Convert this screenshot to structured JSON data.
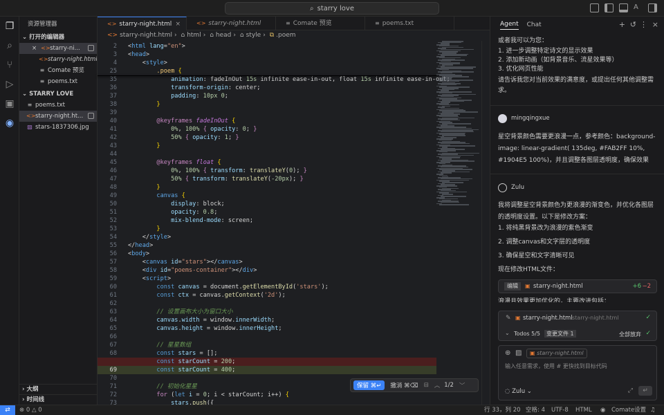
{
  "search": {
    "text": "starry love"
  },
  "sidebar": {
    "title": "资源管理器",
    "open_editors_label": "打开的编辑器",
    "open_editors": [
      {
        "name": "starry-ni...",
        "icon": "html-file-icon",
        "close": "×",
        "selected": true
      },
      {
        "name": "starry-night.html",
        "icon": "html-file-icon",
        "italic": true
      },
      {
        "name": "Comate 预览",
        "icon": "preview-icon"
      },
      {
        "name": "poems.txt",
        "icon": "text-file-icon"
      }
    ],
    "folder_label": "STARRY LOVE",
    "files": [
      {
        "name": "poems.txt",
        "icon": "text-file-icon"
      },
      {
        "name": "starry-night.ht...",
        "icon": "html-file-icon",
        "selected": true
      },
      {
        "name": "stars-1837306.jpg",
        "icon": "image-file-icon"
      }
    ],
    "outline_label": "大纲",
    "timeline_label": "时间线"
  },
  "tabs": [
    {
      "label": "starry-night.html",
      "active": true
    },
    {
      "label": "starry-night.html",
      "italic": true
    },
    {
      "label": "Comate 预览"
    },
    {
      "label": "poems.txt"
    }
  ],
  "breadcrumb": [
    "starry-night.html",
    "html",
    "head",
    "style",
    ".poem"
  ],
  "code_lines": [
    {
      "n": "2",
      "h": "<span class='p'>&lt;</span><span class='t'>html</span> <span class='a'>lang</span><span class='p'>=</span><span class='s'>\"en\"</span><span class='p'>&gt;</span>"
    },
    {
      "n": "3",
      "h": "<span class='p'>&lt;</span><span class='t'>head</span><span class='p'>&gt;</span>"
    },
    {
      "n": "4",
      "h": "    <span class='p'>&lt;</span><span class='t'>style</span><span class='p'>&gt;</span>"
    },
    {
      "n": "25",
      "h": "        <span class='cl'>.poem</span> <span class='y'>{</span>"
    },
    {
      "n": "35",
      "h": "            <span class='a'>animation</span><span class='p'>: fadeInOut </span><span class='num'>15s</span><span class='p'> infinite ease-in-out, float </span><span class='num'>15s</span><span class='p'> infinite ease-in-out;</span>"
    },
    {
      "n": "36",
      "h": "            <span class='a'>transform-origin</span><span class='p'>: center;</span>"
    },
    {
      "n": "37",
      "h": "            <span class='a'>padding</span><span class='p'>: </span><span class='num'>10px</span><span class='p'> </span><span class='num'>0</span><span class='p'>;</span>"
    },
    {
      "n": "38",
      "h": "        <span class='y'>}</span>"
    },
    {
      "n": "39",
      "h": ""
    },
    {
      "n": "40",
      "h": "        <span class='k'>@keyframes</span> <span class='kf'>fadeInOut</span> <span class='y'>{</span>"
    },
    {
      "n": "41",
      "h": "            <span class='num'>0%</span><span class='p'>, </span><span class='num'>100%</span> <span class='k'>{</span> <span class='a'>opacity</span><span class='p'>: </span><span class='num'>0</span><span class='p'>; </span><span class='k'>}</span>"
    },
    {
      "n": "42",
      "h": "            <span class='num'>50%</span> <span class='k'>{</span> <span class='a'>opacity</span><span class='p'>: </span><span class='num'>1</span><span class='p'>; </span><span class='k'>}</span>"
    },
    {
      "n": "43",
      "h": "        <span class='y'>}</span>"
    },
    {
      "n": "44",
      "h": ""
    },
    {
      "n": "45",
      "h": "        <span class='k'>@keyframes</span> <span class='kf'>float</span> <span class='y'>{</span>"
    },
    {
      "n": "46",
      "h": "            <span class='num'>0%</span><span class='p'>, </span><span class='num'>100%</span> <span class='k'>{</span> <span class='a'>transform</span><span class='p'>: </span><span class='f'>translateY</span><span class='p'>(</span><span class='num'>0</span><span class='p'>); </span><span class='k'>}</span>"
    },
    {
      "n": "47",
      "h": "            <span class='num'>50%</span> <span class='k'>{</span> <span class='a'>transform</span><span class='p'>: </span><span class='f'>translateY</span><span class='p'>(</span><span class='num'>-20px</span><span class='p'>); </span><span class='k'>}</span>"
    },
    {
      "n": "48",
      "h": "        <span class='y'>}</span>"
    },
    {
      "n": "49",
      "h": "        <span class='t'>canvas</span> <span class='y'>{</span>"
    },
    {
      "n": "50",
      "h": "            <span class='a'>display</span><span class='p'>: block;</span>"
    },
    {
      "n": "51",
      "h": "            <span class='a'>opacity</span><span class='p'>: </span><span class='num'>0.8</span><span class='p'>;</span>"
    },
    {
      "n": "52",
      "h": "            <span class='a'>mix-blend-mode</span><span class='p'>: screen;</span>"
    },
    {
      "n": "53",
      "h": "        <span class='y'>}</span>"
    },
    {
      "n": "54",
      "h": "    <span class='p'>&lt;/</span><span class='t'>style</span><span class='p'>&gt;</span>"
    },
    {
      "n": "55",
      "h": "<span class='p'>&lt;/</span><span class='t'>head</span><span class='p'>&gt;</span>"
    },
    {
      "n": "56",
      "h": "<span class='p'>&lt;</span><span class='t'>body</span><span class='p'>&gt;</span>"
    },
    {
      "n": "57",
      "h": "    <span class='p'>&lt;</span><span class='t'>canvas</span> <span class='a'>id</span><span class='p'>=</span><span class='s'>\"stars\"</span><span class='p'>&gt;&lt;/</span><span class='t'>canvas</span><span class='p'>&gt;</span>"
    },
    {
      "n": "58",
      "h": "    <span class='p'>&lt;</span><span class='t'>div</span> <span class='a'>id</span><span class='p'>=</span><span class='s'>\"poems-container\"</span><span class='p'>&gt;&lt;/</span><span class='t'>div</span><span class='p'>&gt;</span>"
    },
    {
      "n": "59",
      "h": "    <span class='p'>&lt;</span><span class='t'>script</span><span class='p'>&gt;</span>"
    },
    {
      "n": "60",
      "h": "        <span class='kw'>const</span> <span class='v'>canvas</span> <span class='p'>= document.</span><span class='f'>getElementById</span><span class='p'>(</span><span class='s'>'stars'</span><span class='p'>);</span>"
    },
    {
      "n": "61",
      "h": "        <span class='kw'>const</span> <span class='v'>ctx</span> <span class='p'>= canvas.</span><span class='f'>getContext</span><span class='p'>(</span><span class='s'>'2d'</span><span class='p'>);</span>"
    },
    {
      "n": "62",
      "h": ""
    },
    {
      "n": "63",
      "h": "        <span class='cm'>// 设置画布大小为窗口大小</span>"
    },
    {
      "n": "64",
      "h": "        <span class='v'>canvas</span><span class='p'>.</span><span class='v'>width</span> <span class='p'>= window.</span><span class='v'>innerWidth</span><span class='p'>;</span>"
    },
    {
      "n": "65",
      "h": "        <span class='v'>canvas</span><span class='p'>.</span><span class='v'>height</span> <span class='p'>= window.</span><span class='v'>innerHeight</span><span class='p'>;</span>"
    },
    {
      "n": "66",
      "h": ""
    },
    {
      "n": "67",
      "h": "        <span class='cm'>// 星星数组</span>"
    },
    {
      "n": "68",
      "h": "        <span class='kw'>const</span> <span class='v'>stars</span> <span class='p'>= [];</span>"
    },
    {
      "n": "",
      "h": "        <span class='kw'>const</span> <span class='v'>starCount</span> <span class='p'>= </span><span class='num'>200</span><span class='p'>;</span>",
      "cls": "del"
    },
    {
      "n": "69",
      "h": "        <span class='kw'>const</span> <span class='v'>starCount</span> <span class='p'>= </span><span class='num'>400</span><span class='p'>;</span>",
      "cls": "add"
    },
    {
      "n": "70",
      "h": ""
    },
    {
      "n": "71",
      "h": "        <span class='cm'>// 初始化星星</span>"
    },
    {
      "n": "72",
      "h": "        <span class='k'>for</span> <span class='p'>(</span><span class='kw'>let</span> <span class='v'>i</span> <span class='p'>= </span><span class='num'>0</span><span class='p'>; i &lt; starCount; i++) </span><span class='y'>{</span>"
    },
    {
      "n": "73",
      "h": "            <span class='v'>stars</span><span class='p'>.</span><span class='f'>push</span><span class='p'>({</span>"
    }
  ],
  "diffbar": {
    "keep": "保留 ⌘↵",
    "undo": "撤消 ⌘⌫",
    "count": "1/2"
  },
  "right_panel": {
    "tab_agent": "Agent",
    "tab_chat": "Chat",
    "intro": "或者我可以为您：",
    "options": [
      "1. 进一步调整特定诗文的显示效果",
      "2. 添加新动画（如背景音乐、流星效果等）",
      "3. 优化网页性能"
    ],
    "closing": "请告诉我您对当前效果的满意度，或提出任何其他调整需求。",
    "user_name": "mingqingxue",
    "user_msg": "星空背景颜色需要更浪漫一点，参考颜色：background-image: linear-gradient( 135deg, #FAB2FF 10%, #1904E5 100%)，并且调整各图层透明度，确保效果",
    "bot_name": "Zulu",
    "bot_msg": "我将调整星空背景颜色为更浪漫的渐变色，并优化各图层的透明度设置。以下是修改方案：",
    "steps": [
      "1. 将纯黑背景改为浪漫的紫色渐变",
      "2. 调整canvas和文字层的透明度",
      "3. 确保星空和文字清晰可见"
    ],
    "now_edit": "现在修改HTML文件：",
    "edit_chip": {
      "tag": "编辑",
      "file": "starry-night.html",
      "plus": "+6",
      "minus": "−2"
    },
    "truncated": "浪漫且效果更加优化的，主要改进包括：",
    "file_row": {
      "name": "starry-night.html",
      "path": "starry-night.html"
    },
    "todos": {
      "label": "Todos 5/5",
      "changed": "变更文件 1",
      "discard": "全部放弃"
    },
    "input": {
      "ref": "starry-night.html",
      "placeholder": "输入任意需求，使用 # 更快找到目标代码",
      "model": "Zulu"
    }
  },
  "status": {
    "errors": "0",
    "warnings": "0",
    "pos": "行 33，列 20",
    "spaces": "空格: 4",
    "enc": "UTF-8",
    "lang": "HTML",
    "settings": "Comate设置"
  }
}
